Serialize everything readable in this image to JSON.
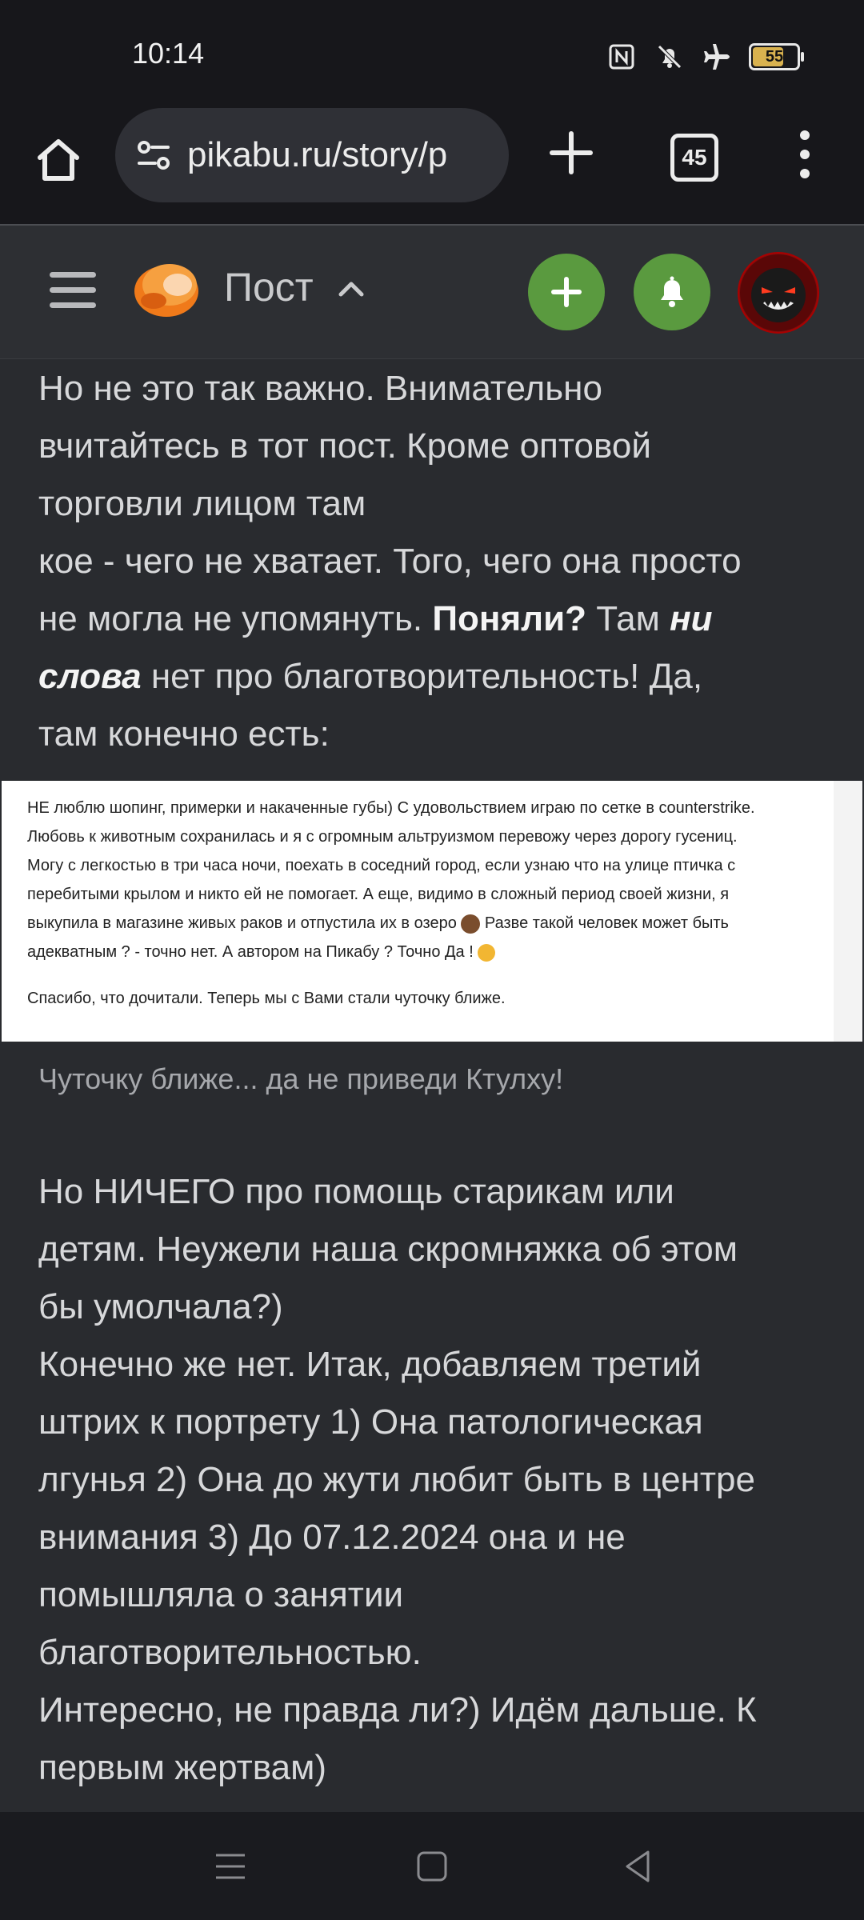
{
  "status": {
    "time": "10:14",
    "battery": "55",
    "icons": [
      "nfc-icon",
      "mute-icon",
      "airplane-icon",
      "battery-icon"
    ]
  },
  "browser": {
    "url": "pikabu.ru/story/p",
    "tabs_count": "45"
  },
  "header": {
    "title": "Пост",
    "accent_color": "#5a9a3f"
  },
  "article": {
    "paragraph1": {
      "line1": "Но не это так важно. Внимательно",
      "line2": "вчитайтесь в тот пост. Кроме оптовой",
      "line3": "торговли лицом там",
      "line4": "кое - чего не хватает. Того, чего она просто",
      "line5_a": "не могла не упомянуть. ",
      "line5_bold": "Поняли?",
      "line5_b": " Там ",
      "line5_italic": "ни",
      "line6_italic": "слова",
      "line6_b": " нет про благотворительность! Да,",
      "line7": "там конечно есть:"
    },
    "quote": {
      "line1": "НЕ люблю шопинг, примерки и накаченные губы) С удовольствием играю по сетке в counterstrike.",
      "line2": "Любовь к животным сохранилась и я с огромным альтруизмом перевожу через дорогу гусениц.",
      "line3": "Могу с легкостью в три часа ночи, поехать в соседний город, если узнаю что на улице птичка с",
      "line4": "перебитыми крылом и никто ей не помогает. А еще, видимо в сложный период своей жизни, я",
      "line5_a": "выкупила в магазине живых раков и отпустила их в озеро ",
      "line5_b": " Разве такой человек может быть",
      "line6_a": "адекватным ? - точно нет. А автором на Пикабу ? Точно Да ! ",
      "thanks": "Спасибо, что дочитали. Теперь мы с Вами стали чуточку ближе."
    },
    "caption": "Чуточку ближе... да не приведи Ктулху!",
    "paragraph2": {
      "line1": "Но НИЧЕГО про помощь старикам или",
      "line2": "детям. Неужели наша скромняжка об этом",
      "line3": "бы умолчала?)",
      "line4": "Конечно же нет. Итак, добавляем третий",
      "line5": "штрих к портрету 1) Она патологическая",
      "line6": "лгунья 2) Она до жути любит быть в центре",
      "line7": "внимания 3) До 07.12.2024 она и не",
      "line8": "помышляла о занятии",
      "line9": "благотворительностью.",
      "line10": "Интересно, не правда ли?) Идём дальше. К",
      "line11": "первым жертвам)"
    }
  }
}
